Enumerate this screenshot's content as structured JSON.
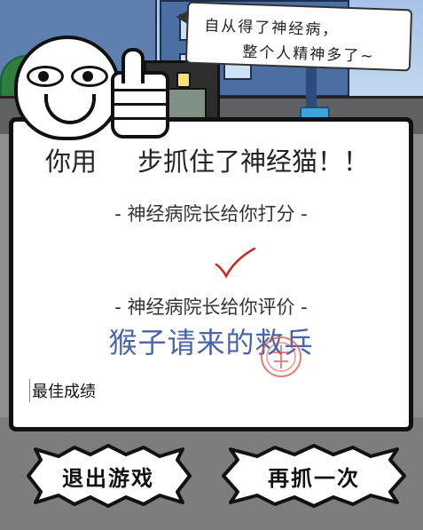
{
  "speech": {
    "line1": "自从得了神经病，",
    "line2": "整个人精神多了~"
  },
  "result": {
    "headline_prefix": "你用",
    "headline_steps": "",
    "headline_suffix": "步抓住了神经猫！！",
    "score_label": "- 神经病院长给你打分 -",
    "score_mark_icon": "check-mark-icon",
    "review_label": "- 神经病院长给你评价 -",
    "review_text": "猴子请来的救兵",
    "best_score_label": "最佳成绩"
  },
  "buttons": {
    "exit_label": "退出游戏",
    "retry_label": "再抓一次"
  },
  "colors": {
    "review_text": "#4a64a7",
    "check_mark": "#c62828",
    "stamp": "#d9534f"
  }
}
